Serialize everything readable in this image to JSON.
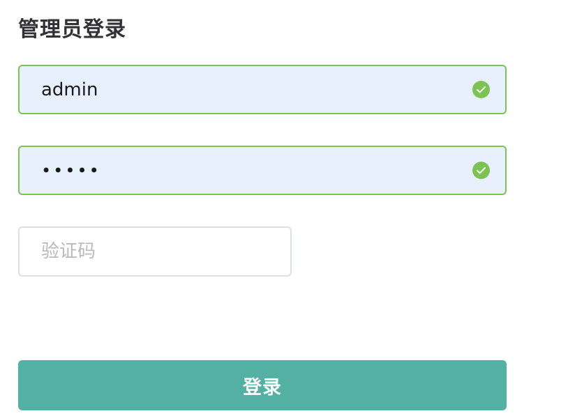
{
  "form": {
    "title": "管理员登录",
    "username": {
      "value": "admin",
      "status_icon": "check-circle-icon"
    },
    "password": {
      "masked_value": "•••••",
      "status_icon": "check-circle-icon"
    },
    "captcha": {
      "value": "",
      "placeholder": "验证码"
    },
    "submit_label": "登录"
  },
  "colors": {
    "valid_border": "#7cc352",
    "valid_fill": "#e8effd",
    "check_icon": "#7cc352",
    "button_bg": "#52b1a3",
    "title_text": "#303133",
    "placeholder_text": "#b8bac0",
    "neutral_border": "#dcdfe6"
  }
}
